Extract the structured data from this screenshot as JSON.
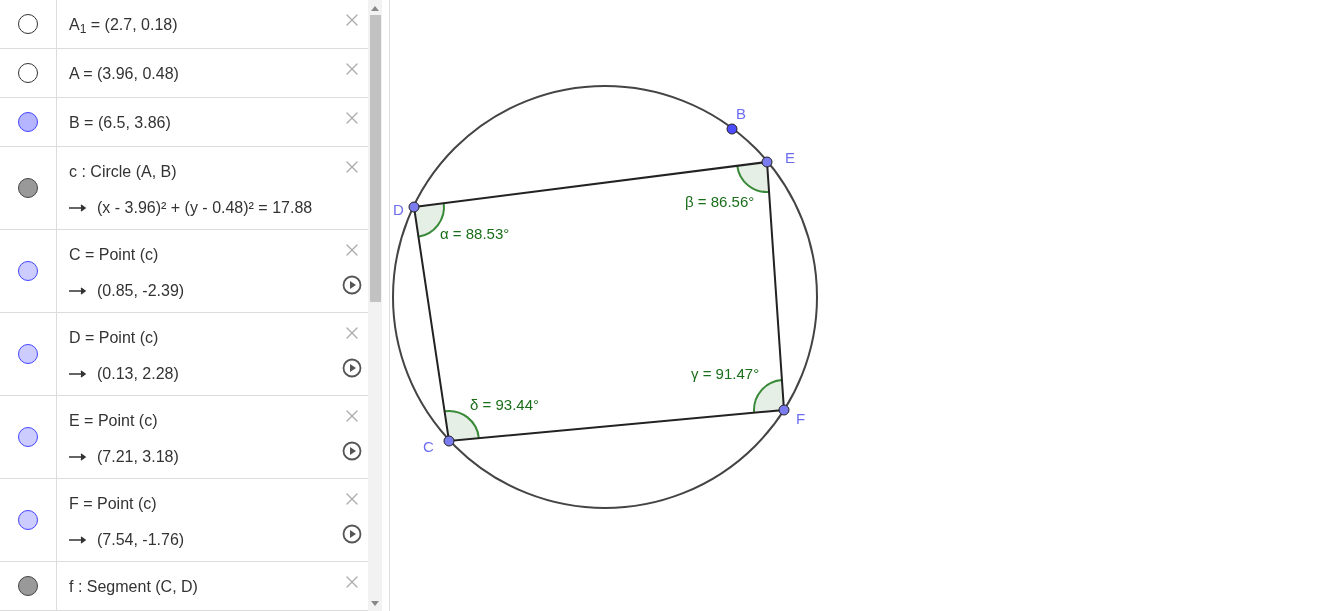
{
  "algebra_view": {
    "rows": [
      {
        "visible": false,
        "definition": "A$_{1}$ = (2.7, 0.18)",
        "play_button": false
      },
      {
        "visible": false,
        "definition": "A = (3.96, 0.48)",
        "play_button": false
      },
      {
        "visible": true,
        "color": "#b4b4ff",
        "definition": "B = (6.5, 3.86)",
        "play_button": false
      },
      {
        "visible": true,
        "color": "#999999",
        "definition": "c : Circle (A, B)",
        "value": "(x - 3.96)² + (y - 0.48)² = 17.88",
        "play_button": false
      },
      {
        "visible": true,
        "color": "#ccccff",
        "definition": "C = Point (c)",
        "value": "(0.85, -2.39)",
        "play_button": true
      },
      {
        "visible": true,
        "color": "#ccccff",
        "definition": "D = Point (c)",
        "value": "(0.13, 2.28)",
        "play_button": true
      },
      {
        "visible": true,
        "color": "#ccccff",
        "definition": "E = Point (c)",
        "value": "(7.21, 3.18)",
        "play_button": true
      },
      {
        "visible": true,
        "color": "#ccccff",
        "definition": "F = Point (c)",
        "value": "(7.54, -1.76)",
        "play_button": true
      },
      {
        "visible": true,
        "color": "#999999",
        "definition": "f : Segment (C, D)",
        "play_button": false
      }
    ]
  },
  "graphics": {
    "points": [
      {
        "label": "B"
      },
      {
        "label": "E"
      },
      {
        "label": "D"
      },
      {
        "label": "C"
      },
      {
        "label": "F"
      }
    ],
    "angles": [
      {
        "label": "α = 88.53°"
      },
      {
        "label": "β = 86.56°"
      },
      {
        "label": "γ = 91.47°"
      },
      {
        "label": "δ = 93.44°"
      }
    ]
  }
}
